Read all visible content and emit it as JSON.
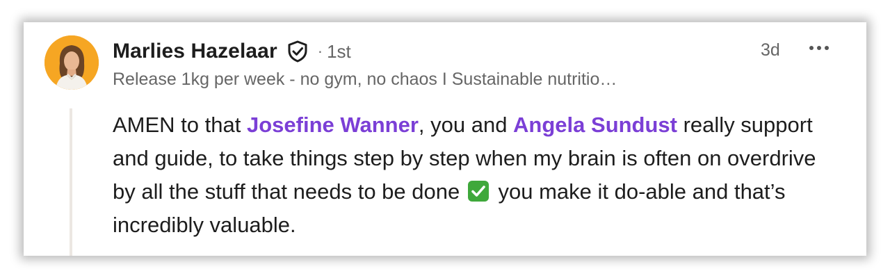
{
  "comment": {
    "author": {
      "name": "Marlies Hazelaar",
      "degree": "1st",
      "separator": "·",
      "headline": "Release 1kg per week - no gym, no chaos I Sustainable nutritio…",
      "avatar_icon": "profile-photo"
    },
    "timestamp": "3d",
    "more_icon": "ellipsis-icon",
    "verified_icon": "verified-shield-icon",
    "body": {
      "text_1": "AMEN to that ",
      "mention_1": "Josefine Wanner",
      "text_2": ", you and ",
      "mention_2": "Angela Sundust",
      "text_3": " really support and guide, to take things step by step when my brain is often on overdrive by all the stuff that needs to be done ",
      "emoji": "check-mark-button-icon",
      "text_4": " you make it do-able and that’s incredibly valuable."
    }
  },
  "colors": {
    "mention": "#7b3fd6",
    "avatar_bg": "#f6a623",
    "check_green": "#3fa83b",
    "muted_text": "#666666",
    "thread_line": "#ece7e2"
  }
}
